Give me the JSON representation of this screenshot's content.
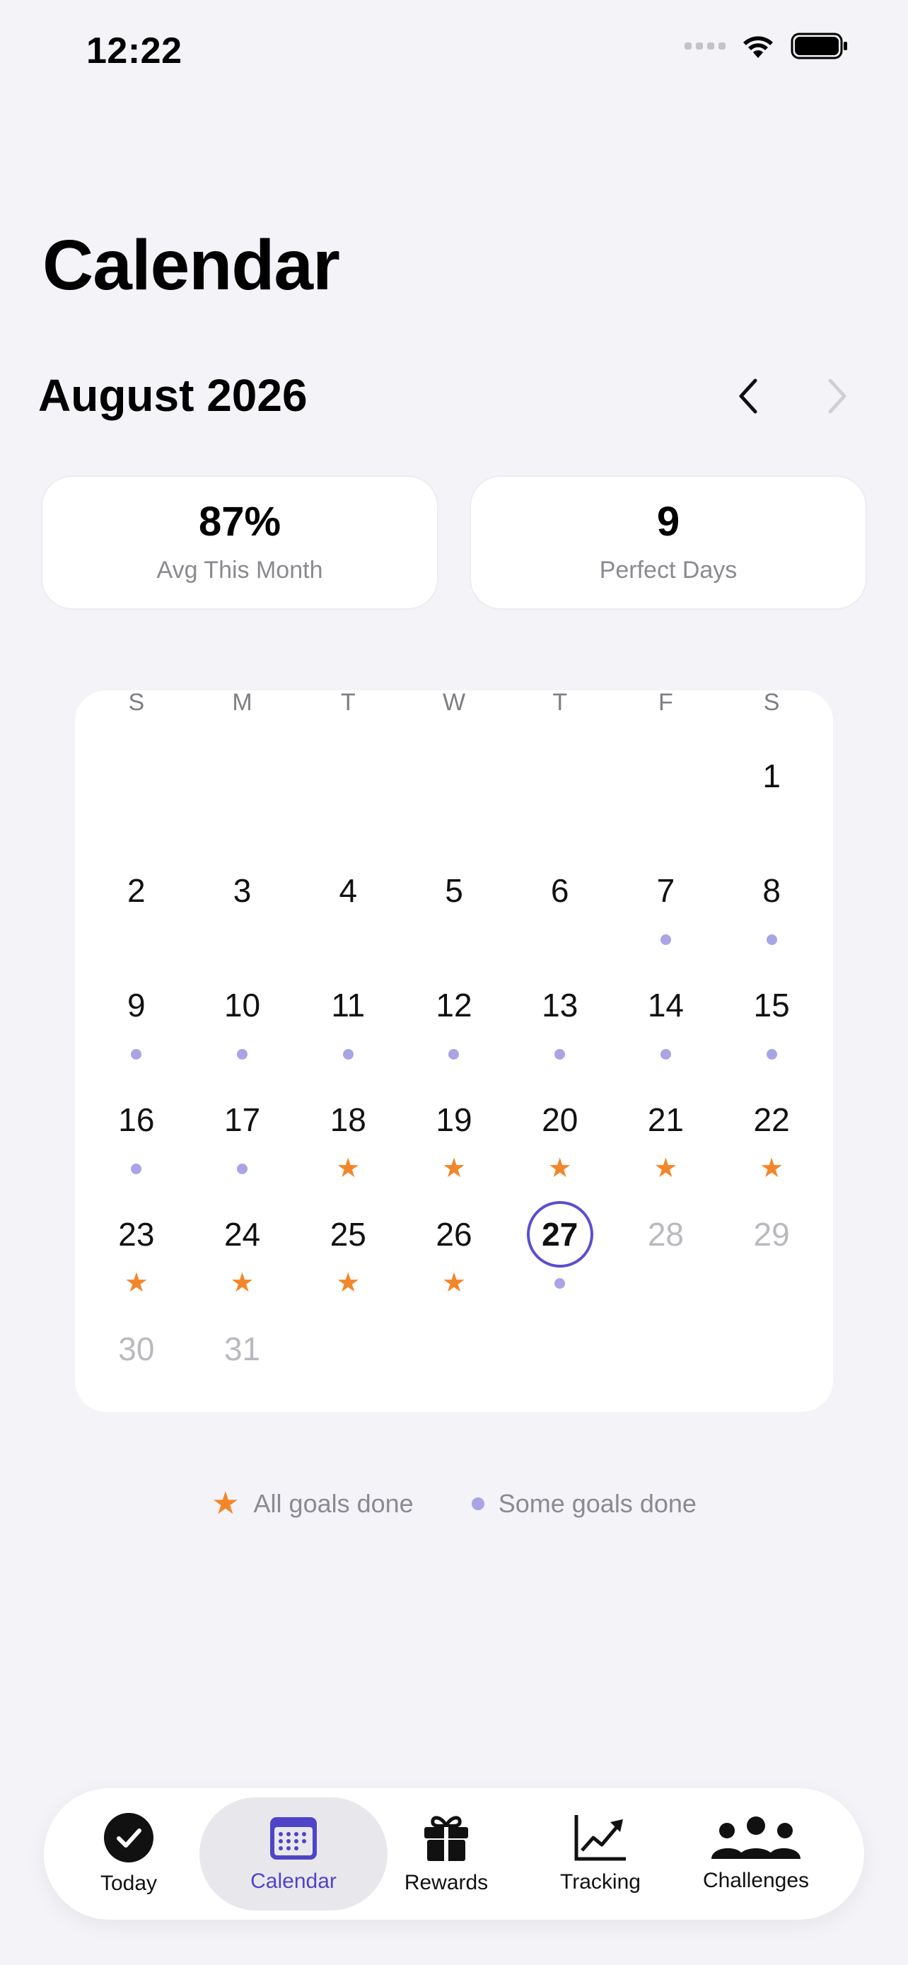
{
  "status_bar": {
    "time": "12:22"
  },
  "header": {
    "title": "Calendar"
  },
  "month": {
    "label": "August 2026"
  },
  "stats": [
    {
      "value": "87%",
      "label": "Avg This Month"
    },
    {
      "value": "9",
      "label": "Perfect Days"
    }
  ],
  "weekdays": [
    "S",
    "M",
    "T",
    "W",
    "T",
    "F",
    "S"
  ],
  "days": [
    {
      "num": "",
      "marker": "none"
    },
    {
      "num": "",
      "marker": "none"
    },
    {
      "num": "",
      "marker": "none"
    },
    {
      "num": "",
      "marker": "none"
    },
    {
      "num": "",
      "marker": "none"
    },
    {
      "num": "",
      "marker": "none"
    },
    {
      "num": "1",
      "marker": "none"
    },
    {
      "num": "2",
      "marker": "none"
    },
    {
      "num": "3",
      "marker": "none"
    },
    {
      "num": "4",
      "marker": "none"
    },
    {
      "num": "5",
      "marker": "none"
    },
    {
      "num": "6",
      "marker": "none"
    },
    {
      "num": "7",
      "marker": "dot"
    },
    {
      "num": "8",
      "marker": "dot"
    },
    {
      "num": "9",
      "marker": "dot"
    },
    {
      "num": "10",
      "marker": "dot"
    },
    {
      "num": "11",
      "marker": "dot"
    },
    {
      "num": "12",
      "marker": "dot"
    },
    {
      "num": "13",
      "marker": "dot"
    },
    {
      "num": "14",
      "marker": "dot"
    },
    {
      "num": "15",
      "marker": "dot"
    },
    {
      "num": "16",
      "marker": "dot"
    },
    {
      "num": "17",
      "marker": "dot"
    },
    {
      "num": "18",
      "marker": "star"
    },
    {
      "num": "19",
      "marker": "star"
    },
    {
      "num": "20",
      "marker": "star"
    },
    {
      "num": "21",
      "marker": "star"
    },
    {
      "num": "22",
      "marker": "star"
    },
    {
      "num": "23",
      "marker": "star"
    },
    {
      "num": "24",
      "marker": "star"
    },
    {
      "num": "25",
      "marker": "star"
    },
    {
      "num": "26",
      "marker": "star"
    },
    {
      "num": "27",
      "marker": "dot",
      "today": true
    },
    {
      "num": "28",
      "marker": "none",
      "future": true
    },
    {
      "num": "29",
      "marker": "none",
      "future": true
    },
    {
      "num": "30",
      "marker": "none",
      "future": true
    },
    {
      "num": "31",
      "marker": "none",
      "future": true
    }
  ],
  "legend": {
    "all_done": "All goals done",
    "some_done": "Some goals done"
  },
  "tabs": [
    {
      "label": "Today",
      "icon": "checkmark-circle-icon"
    },
    {
      "label": "Calendar",
      "icon": "calendar-icon",
      "active": true
    },
    {
      "label": "Rewards",
      "icon": "gift-icon"
    },
    {
      "label": "Tracking",
      "icon": "chart-line-icon"
    },
    {
      "label": "Challenges",
      "icon": "people-icon"
    }
  ],
  "colors": {
    "accent": "#5a4fd0",
    "star": "#f3862a",
    "dot": "#a9a4e6",
    "background": "#f3f3f8"
  }
}
